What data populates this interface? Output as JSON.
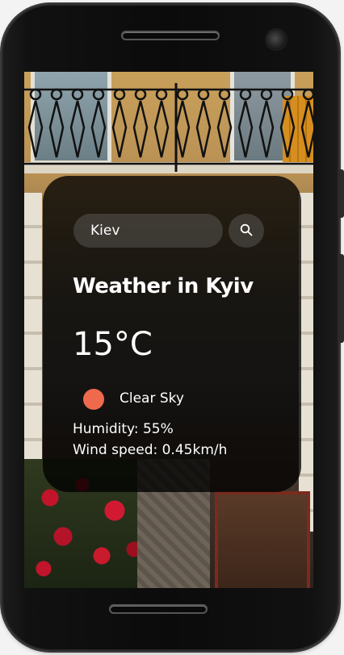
{
  "search": {
    "value": "Kiev",
    "placeholder": "Search"
  },
  "weather": {
    "title": "Weather in Kyiv",
    "temperature": "15°C",
    "condition": "Clear Sky",
    "condition_icon": "sun-icon",
    "humidity": "Humidity: 55%",
    "wind": "Wind speed: 0.45km/h"
  },
  "colors": {
    "card_background": "#000000",
    "sun": "#ef6a4c",
    "text": "#ffffff"
  }
}
